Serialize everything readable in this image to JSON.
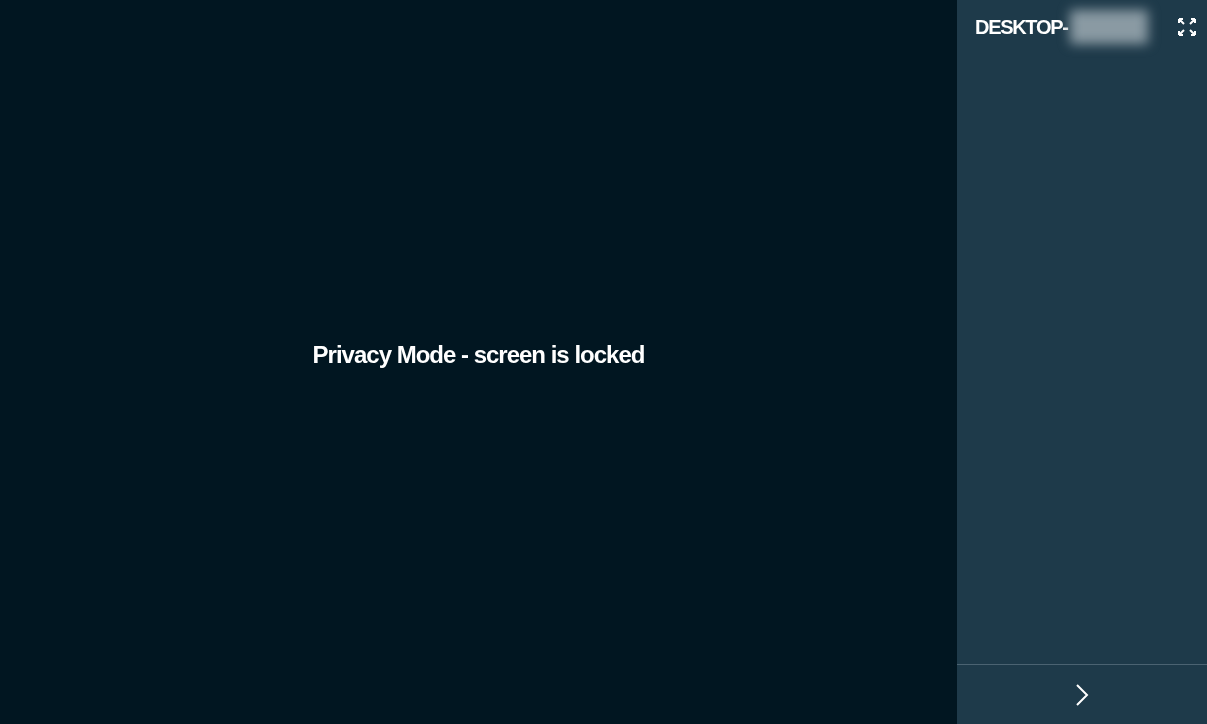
{
  "screen": {
    "message": "Privacy Mode - screen is locked"
  },
  "sidebar": {
    "title": "DESKTOP-",
    "title_redacted": true
  }
}
